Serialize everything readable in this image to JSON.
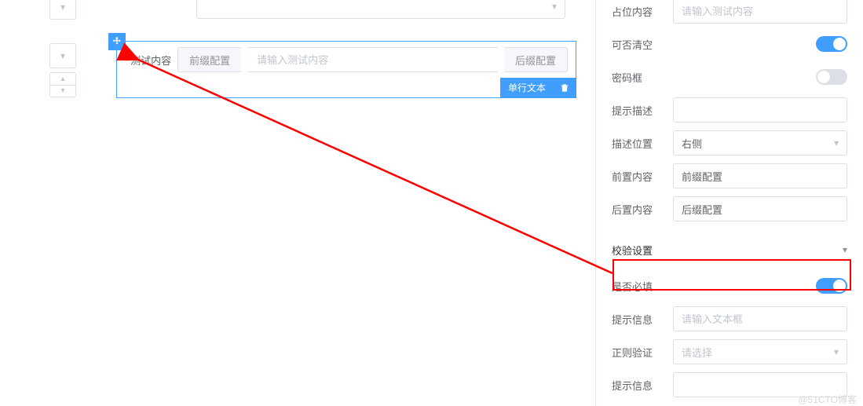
{
  "canvas": {
    "field_label": "测试内容",
    "prefix_addon": "前缀配置",
    "main_placeholder": "请输入测试内容",
    "suffix_addon": "后缀配置",
    "tag_label": "单行文本",
    "truncated_top_input_placeholder": ""
  },
  "props": {
    "placeholder_content": {
      "label": "占位内容",
      "placeholder": "请输入测试内容"
    },
    "clearable": {
      "label": "可否清空",
      "on": true
    },
    "password": {
      "label": "密码框",
      "on": false
    },
    "tooltip_desc": {
      "label": "提示描述",
      "value": ""
    },
    "desc_position": {
      "label": "描述位置",
      "value": "右侧"
    },
    "prepend": {
      "label": "前置内容",
      "value": "前缀配置"
    },
    "append": {
      "label": "后置内容",
      "value": "后缀配置"
    }
  },
  "validation": {
    "section_title": "校验设置",
    "required": {
      "label": "是否必填",
      "on": true
    },
    "tip_message_1": {
      "label": "提示信息",
      "placeholder": "请输入文本框"
    },
    "regex": {
      "label": "正则验证",
      "placeholder": "请选择"
    },
    "tip_message_2": {
      "label": "提示信息",
      "value": ""
    }
  },
  "watermark": "@51CTO博客"
}
